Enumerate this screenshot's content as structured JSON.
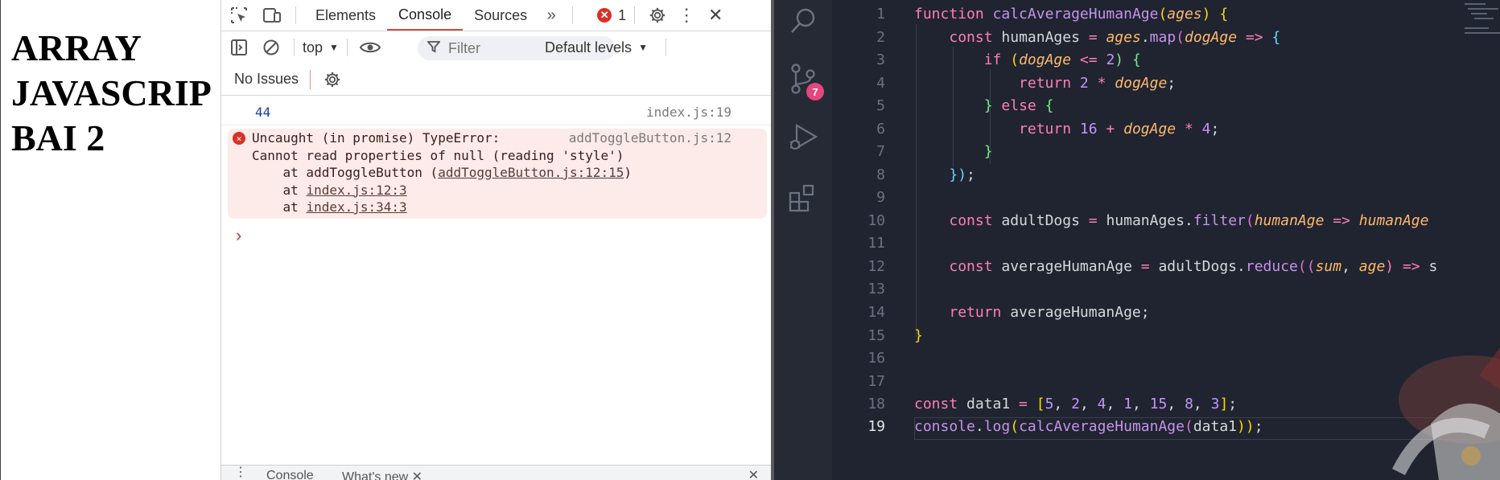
{
  "webpage": {
    "heading_lines": "ARRAY\nJAVASCRIP\nBAI 2"
  },
  "devtools": {
    "tabs": [
      {
        "label": "Elements",
        "active": false
      },
      {
        "label": "Console",
        "active": true
      },
      {
        "label": "Sources",
        "active": false
      }
    ],
    "error_count": "1",
    "context": "top",
    "filter_placeholder": "Filter",
    "levels": "Default levels",
    "issues": "No Issues",
    "console": {
      "log_value": "44",
      "log_source": "index.js:19",
      "error": {
        "line1": "Uncaught (in promise) TypeError:",
        "line1_source": "addToggleButton.js:12",
        "line2": "Cannot read properties of null (reading 'style')",
        "stack": [
          {
            "prefix": "    at addToggleButton (",
            "link": "addToggleButton.js:12:15",
            "suffix": ")"
          },
          {
            "prefix": "    at ",
            "link": "index.js:12:3",
            "suffix": ""
          },
          {
            "prefix": "    at ",
            "link": "index.js:34:3",
            "suffix": ""
          }
        ]
      },
      "prompt": "›"
    },
    "drawer": {
      "console_tab": "Console",
      "whats_new_tab": "What's new"
    }
  },
  "vscode": {
    "scm_badge": "7",
    "current_line": "19",
    "line_numbers": [
      "1",
      "2",
      "3",
      "4",
      "5",
      "6",
      "7",
      "8",
      "9",
      "10",
      "11",
      "12",
      "13",
      "14",
      "15",
      "16",
      "17",
      "18",
      "19"
    ],
    "accent_colors": {
      "keyword": "#ff7eb6",
      "function": "#c792ea",
      "parameter": "#ffb86c",
      "number": "#c594ff",
      "badge": "#e7457f"
    },
    "code": {
      "l1": [
        "function ",
        "calcAverageHumanAge",
        "(",
        "ages",
        ") {"
      ],
      "l2": [
        "const ",
        "humanAges",
        " = ",
        "ages",
        ".",
        "map",
        "(",
        "dogAge",
        " => ",
        "{"
      ],
      "l3": [
        "if ",
        "(",
        "dogAge",
        " <= ",
        "2",
        ") {"
      ],
      "l4": [
        "return ",
        "2",
        " * ",
        "dogAge",
        ";"
      ],
      "l5": [
        "} ",
        "else ",
        "{"
      ],
      "l6": [
        "return ",
        "16",
        " + ",
        "dogAge",
        " * ",
        "4",
        ";"
      ],
      "l7": [
        "}"
      ],
      "l8": [
        "})",
        ";"
      ],
      "l10": [
        "const ",
        "adultDogs",
        " = ",
        "humanAges",
        ".",
        "filter",
        "(",
        "humanAge",
        " => ",
        "humanAge"
      ],
      "l12": [
        "const ",
        "averageHumanAge",
        " = ",
        "adultDogs",
        ".",
        "reduce",
        "((",
        "sum",
        ", ",
        "age",
        ") => ",
        "s"
      ],
      "l14": [
        "return ",
        "averageHumanAge",
        ";"
      ],
      "l15": [
        "}"
      ],
      "l18": [
        "const ",
        "data1",
        " = ",
        "[",
        "5",
        ", ",
        "2",
        ", ",
        "4",
        ", ",
        "1",
        ", ",
        "15",
        ", ",
        "8",
        ", ",
        "3",
        "]",
        ";"
      ],
      "l19": [
        "console",
        ".",
        "log",
        "(",
        "calcAverageHumanAge",
        "(",
        "data1",
        "))",
        ";"
      ]
    }
  }
}
